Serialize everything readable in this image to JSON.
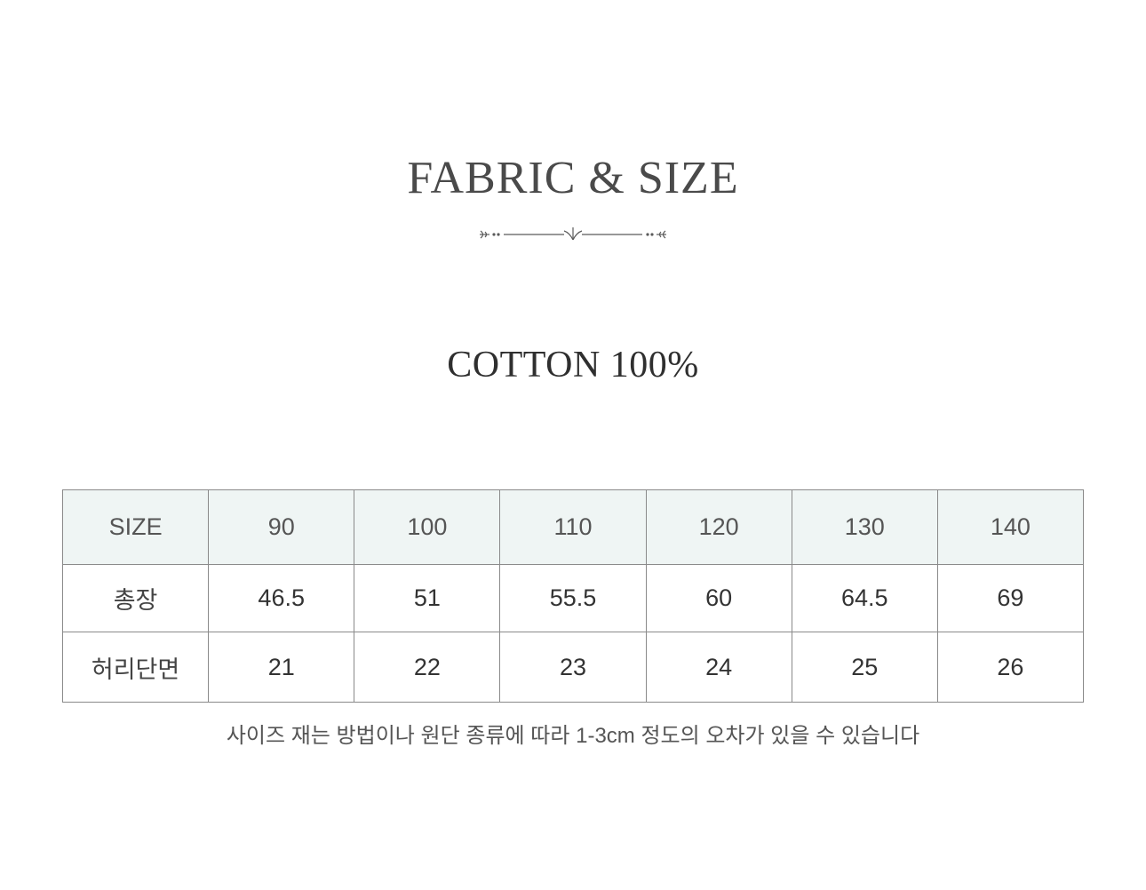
{
  "header": {
    "title": "FABRIC & SIZE",
    "ornament_icon": "flourish-divider-icon"
  },
  "fabric": {
    "composition": "COTTON 100%"
  },
  "size_table": {
    "header_label": "SIZE",
    "sizes": [
      "90",
      "100",
      "110",
      "120",
      "130",
      "140"
    ],
    "rows": [
      {
        "label": "총장",
        "values": [
          "46.5",
          "51",
          "55.5",
          "60",
          "64.5",
          "69"
        ]
      },
      {
        "label": "허리단면",
        "values": [
          "21",
          "22",
          "23",
          "24",
          "25",
          "26"
        ]
      }
    ],
    "header_bg": "#eff5f4",
    "border_color": "#8a8a8a"
  },
  "note": "사이즈 재는 방법이나 원단 종류에 따라 1-3cm 정도의 오차가 있을 수 있습니다"
}
